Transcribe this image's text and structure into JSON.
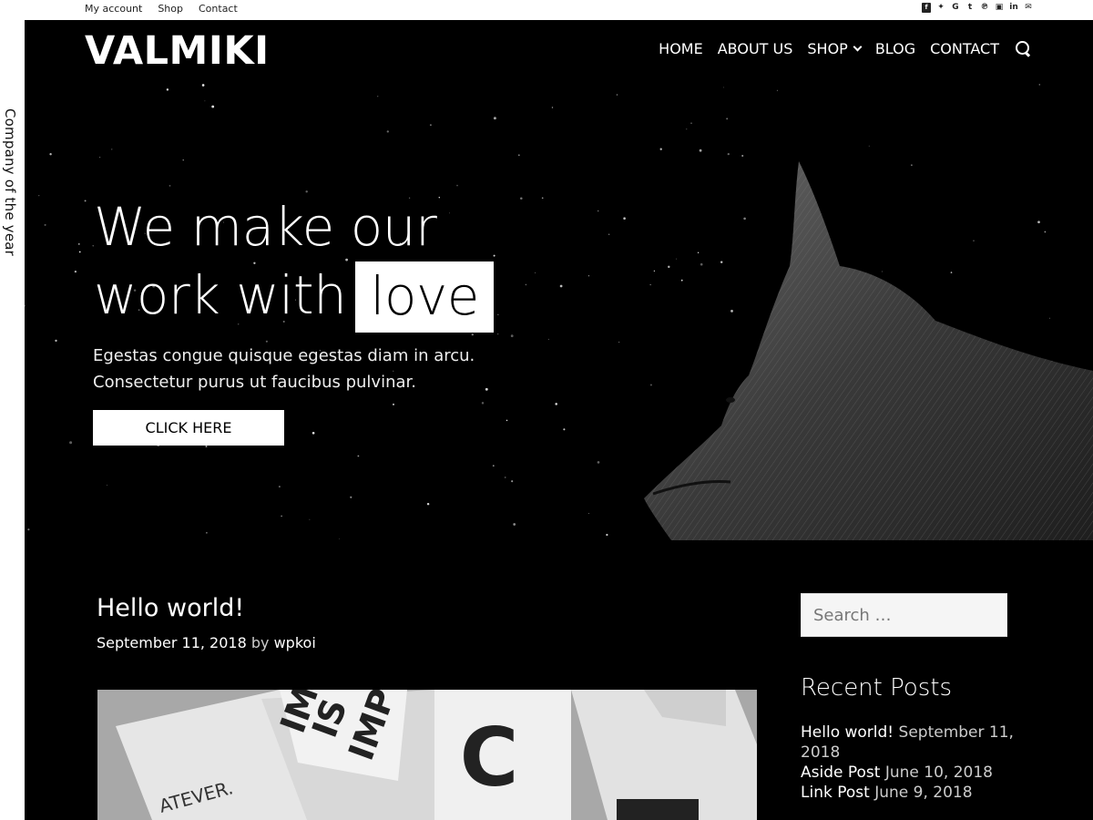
{
  "topbar": {
    "links": [
      "My account",
      "Shop",
      "Contact"
    ],
    "social_icons": [
      "facebook-icon",
      "twitter-icon",
      "google-icon",
      "tumblr-icon",
      "pinterest-icon",
      "youtube-icon",
      "linkedin-icon",
      "email-icon"
    ]
  },
  "side": {
    "text": "Company of the year"
  },
  "header": {
    "logo": "VALMIKI",
    "nav": [
      "HOME",
      "ABOUT US",
      "SHOP",
      "BLOG",
      "CONTACT"
    ]
  },
  "hero": {
    "line1": "We make our",
    "line2": "work with",
    "highlight": "love",
    "subtitle_line1": "Egestas congue quisque egestas diam in arcu.",
    "subtitle_line2": "Consectetur purus ut faucibus pulvinar.",
    "button": "CLICK HERE"
  },
  "post": {
    "title": "Hello world!",
    "date": "September 11, 2018",
    "by": "by",
    "author": "wpkoi"
  },
  "sidebar": {
    "search_placeholder": "Search …",
    "recent_title": "Recent Posts",
    "recent": [
      {
        "title": "Hello world!",
        "date": "September 11, 2018"
      },
      {
        "title": "Aside Post",
        "date": "June 10, 2018"
      },
      {
        "title": "Link Post",
        "date": "June 9, 2018"
      }
    ]
  },
  "colors": {
    "background": "#000000",
    "accent": "#ffffff"
  }
}
